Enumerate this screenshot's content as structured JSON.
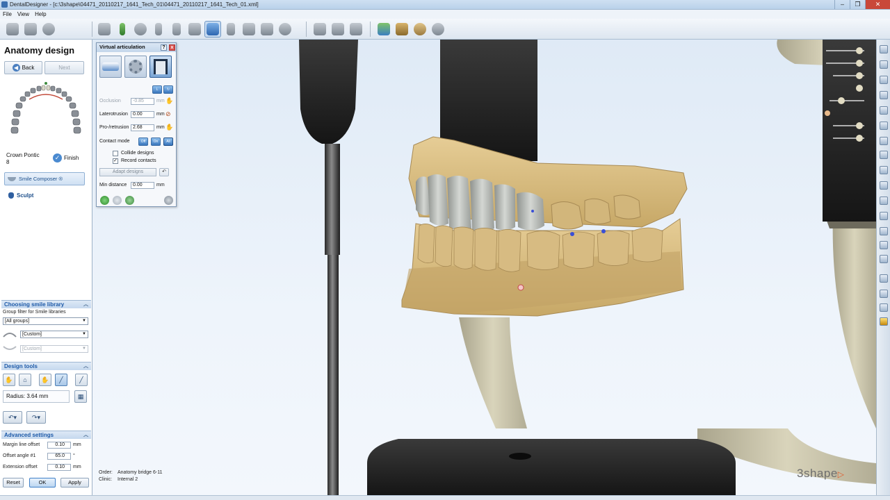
{
  "window": {
    "title": "DentalDesigner - [c:\\3shape\\04471_20110217_1641_Tech_01\\04471_20110217_1641_Tech_01.xml]",
    "minimize": "‒",
    "maximize": "❐",
    "close": "✕"
  },
  "menu": [
    "File",
    "View",
    "Help"
  ],
  "left": {
    "title": "Anatomy design",
    "back_label": "Back",
    "next_label": "Next",
    "crown_line1": "Crown Pontic",
    "crown_line2": "8",
    "finish_label": "Finish",
    "smile_composer_label": "Smile Composer ®",
    "sculpt_label": "Sculpt",
    "choosing": {
      "header": "Choosing smile library",
      "filter_label": "Group filter for Smile libraries",
      "group_value": "[All groups]",
      "custom1": "[Custom]",
      "custom2": "[Custom]"
    },
    "design_tools": {
      "header": "Design tools",
      "radius": "Radius: 3.64 mm"
    },
    "advanced": {
      "header": "Advanced settings",
      "rows": [
        {
          "label": "Margin line offset",
          "value": "0.10",
          "unit": "mm"
        },
        {
          "label": "Offset angle #1",
          "value": "65.0",
          "unit": "°"
        },
        {
          "label": "Extension offset",
          "value": "0.10",
          "unit": "mm"
        }
      ]
    },
    "buttons": {
      "reset": "Reset",
      "ok": "OK",
      "apply": "Apply"
    }
  },
  "dialog": {
    "title": "Virtual articulation",
    "help": "?",
    "close": "x",
    "occlusion_label": "Occlusion",
    "occlusion_value": "-0.85",
    "laterotrusion_label": "Laterotrusion",
    "laterotrusion_value": "0.00",
    "proretrusion_label": "Pro-/retrusion",
    "proretrusion_value": "2.68",
    "unit": "mm",
    "contact_mode_label": "Contact mode",
    "contact_modes": [
      "Off",
      "On",
      "All"
    ],
    "collide_label": "Collide designs",
    "record_label": "Record contacts",
    "adapt_label": "Adapt designs",
    "min_distance_label": "Min distance",
    "min_distance_value": "0.00"
  },
  "order": {
    "order_label": "Order:",
    "order_value": "Anatomy bridge 6-11",
    "clinic_label": "Clinic:",
    "clinic_value": "Internal 2"
  },
  "logo": "3shape",
  "colors": {
    "accent": "#1e5aa8",
    "model_gold": "#d7b97d",
    "teeth_grey": "#b9bdb8",
    "articulator_dark": "#1c1c1c",
    "articulator_beige": "#c9c3a8"
  }
}
